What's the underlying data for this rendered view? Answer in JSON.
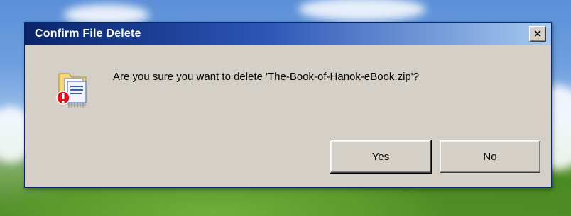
{
  "dialog": {
    "title": "Confirm File Delete",
    "close_glyph": "✕",
    "message": "Are you sure you want to delete 'The-Book-of-Hanok-eBook.zip'?",
    "icon": "delete-file-warning-icon",
    "buttons": {
      "yes_label": "Yes",
      "no_label": "No"
    }
  },
  "colors": {
    "titlebar_start": "#0a246a",
    "titlebar_end": "#a6caf0",
    "window_face": "#d4d0c8",
    "warning_red": "#e0101a"
  }
}
